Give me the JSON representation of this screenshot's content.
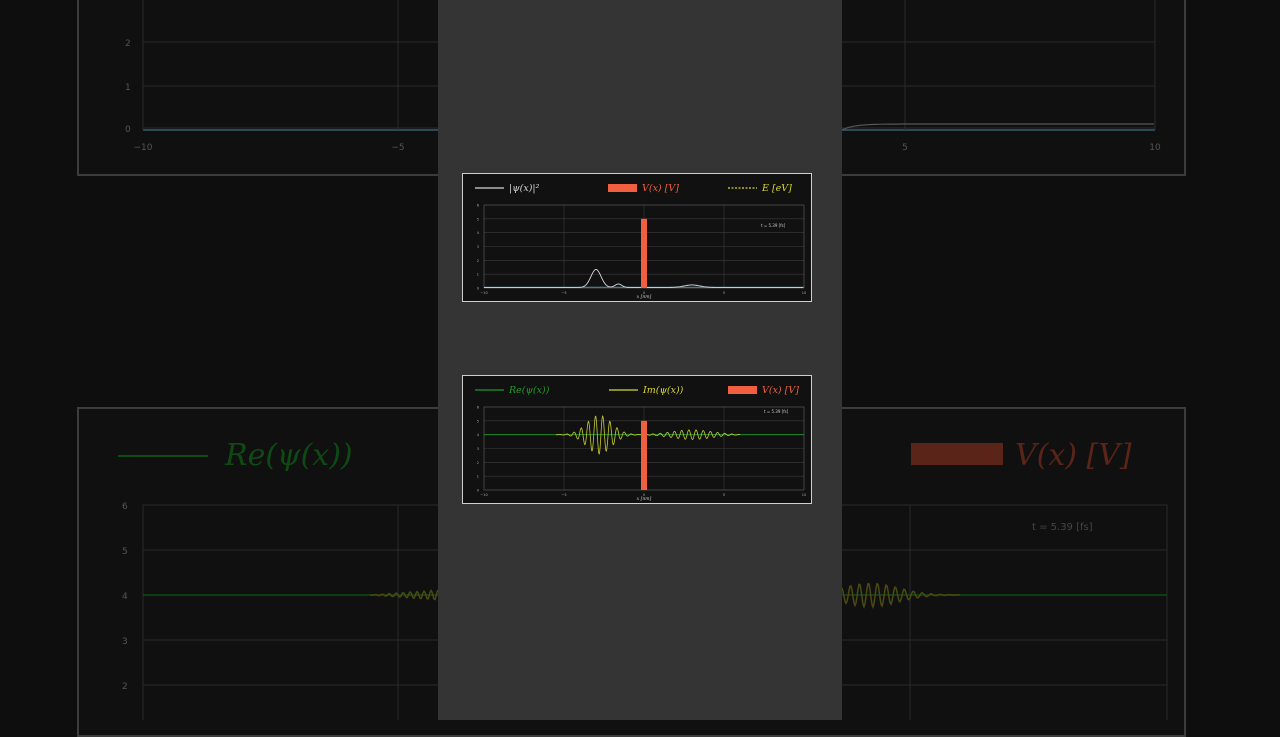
{
  "chart_data": [
    {
      "type": "line",
      "legend": [
        {
          "label": "|ψ(x)|²",
          "color": "#d8d8d8",
          "style": "solid"
        },
        {
          "label": "V(x) [V]",
          "color": "#f06040",
          "style": "bar"
        },
        {
          "label": "E [eV]",
          "color": "#d8d832",
          "style": "dashed"
        }
      ],
      "annotation": "t = 5.39 [fs]",
      "xlabel": "x [nm]",
      "xlim": [
        -10,
        10
      ],
      "ylim": [
        0,
        6
      ],
      "xticks": [
        "−10",
        "−5",
        "0",
        "5",
        "10"
      ],
      "yticks": [
        "0",
        "1",
        "2",
        "3",
        "4",
        "5",
        "6"
      ],
      "grid": true,
      "barrier": {
        "x": 0,
        "width": 0.35,
        "height": 5
      },
      "series": [
        {
          "name": "|ψ(x)|²",
          "color": "#d8d8d8",
          "x": [
            -10,
            -6,
            -5,
            -4,
            -3.5,
            -3,
            -2.6,
            -2.2,
            -2,
            -1.5,
            -1,
            -0.5,
            0,
            1,
            2,
            3,
            4,
            5,
            6,
            10
          ],
          "y": [
            0.05,
            0.06,
            0.1,
            0.3,
            0.8,
            1.35,
            0.9,
            0.3,
            0.2,
            0.25,
            0.1,
            0.05,
            0.05,
            0.05,
            0.1,
            0.2,
            0.15,
            0.08,
            0.05,
            0.05
          ]
        }
      ]
    },
    {
      "type": "line",
      "legend": [
        {
          "label": "Re(ψ(x))",
          "color": "#1f9a2a",
          "style": "solid"
        },
        {
          "label": "Im(ψ(x))",
          "color": "#d8d832",
          "style": "solid"
        },
        {
          "label": "V(x) [V]",
          "color": "#f06040",
          "style": "bar"
        }
      ],
      "annotation": "t = 5.39 [fs]",
      "xlabel": "x [nm]",
      "xlim": [
        -10,
        10
      ],
      "ylim": [
        0,
        6
      ],
      "xticks": [
        "−10",
        "−5",
        "0",
        "5",
        "10"
      ],
      "yticks": [
        "0",
        "1",
        "2",
        "3",
        "4",
        "5",
        "6"
      ],
      "grid": true,
      "baseline": 4,
      "barrier": {
        "x": 0,
        "width": 0.35,
        "height": 5
      }
    }
  ],
  "background": {
    "top_ticks_y": [
      "0",
      "1",
      "2"
    ],
    "top_ticks_x": [
      "−10",
      "−5",
      "5",
      "10"
    ],
    "bottom_legend_left": "Re(ψ(x))",
    "bottom_legend_right": "V(x) [V]",
    "bottom_annotation": "t = 5.39 [fs]",
    "bottom_ticks_y": [
      "6",
      "5",
      "4",
      "3",
      "2"
    ]
  },
  "colors": {
    "strip": "#343434",
    "page": "#0e0e0e",
    "barrier": "#f06040",
    "grid": "#3a3a3a"
  }
}
